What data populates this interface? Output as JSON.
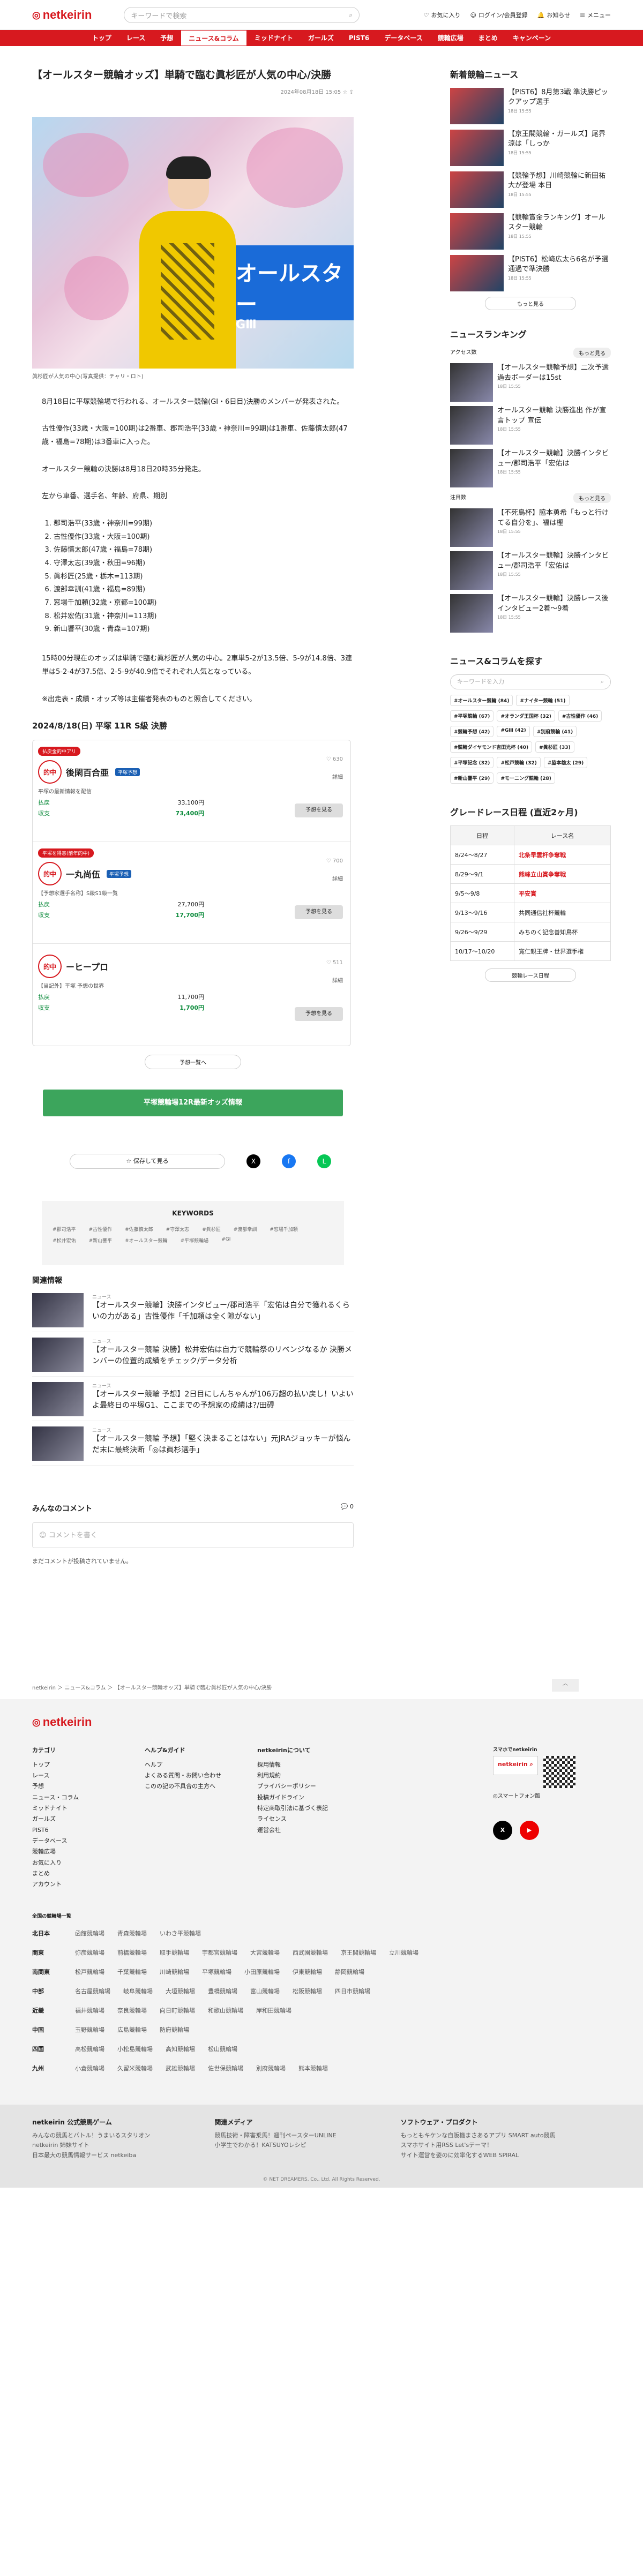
{
  "header": {
    "logo": "netkeirin",
    "search_placeholder": "キーワードで検索",
    "links": [
      "お気に入り",
      "ログイン/会員登録",
      "お知らせ",
      "メニュー"
    ]
  },
  "nav": [
    "トップ",
    "レース",
    "予想",
    "ニュース&コラム",
    "ミッドナイト",
    "ガールズ",
    "PIST6",
    "データベース",
    "競輪広場",
    "まとめ",
    "キャンペーン"
  ],
  "article": {
    "title": "【オールスター競輪オッズ】単騎で臨む眞杉匠が人気の中心/決勝",
    "meta": "2024年08月18日 15:05",
    "caption": "眞杉匠が人気の中心(写真提供：チャリ・ロト)",
    "p1": "8月18日に平塚競輪場で行われる、オールスター競輪(GⅠ・6日目)決勝のメンバーが発表された。",
    "p2": "古性優作(33歳・大阪=100期)は2番車、郡司浩平(33歳・神奈川=99期)は1番車、佐藤慎太郎(47歳・福島=78期)は3番車に入った。",
    "p3": "オールスター競輪の決勝は8月18日20時35分発走。",
    "lineup_intro": "左から車番、選手名、年齢、府県、期別",
    "lineup": [
      "郡司浩平(33歳・神奈川=99期)",
      "古性優作(33歳・大阪=100期)",
      "佐藤慎太郎(47歳・福島=78期)",
      "守澤太志(39歳・秋田=96期)",
      "眞杉匠(25歳・栃木=113期)",
      "渡部幸訓(41歳・福島=89期)",
      "窓場千加頼(32歳・京都=100期)",
      "松井宏佑(31歳・神奈川=113期)",
      "新山響平(30歳・青森=107期)"
    ],
    "p4": "15時00分現在のオッズは単騎で臨む眞杉匠が人気の中心。2車単5-2が13.5倍、5-9が14.8倍、3連単は5-2-4が37.5倍、2-5-9が40.9倍でそれぞれ人気となっている。",
    "note": "※出走表・成績・オッズ等は主催者発表のものと照合してください。"
  },
  "race_heading": "2024/8/18(日) 平塚 11R S級 決勝",
  "cards": [
    {
      "tag": "払戻金的中アリ",
      "name": "後閑百合亜",
      "badge": "平塚予想",
      "desc": "平塚の最新情報を配信",
      "likes": "630",
      "detail": "詳細",
      "rows": [
        [
          "払戻",
          "33,100円"
        ],
        [
          "収支",
          "73,400円"
        ]
      ],
      "bet": "予想を見る"
    },
    {
      "tag": "平塚を得意(前年的中)",
      "name": "一丸尚伍",
      "badge": "平塚予想",
      "desc": "【予想家選手名称】S級S1級一覧",
      "likes": "700",
      "detail": "詳細",
      "rows": [
        [
          "払戻",
          "27,700円"
        ],
        [
          "収支",
          "17,700円"
        ]
      ],
      "bet": "予想を見る"
    },
    {
      "tag": "",
      "name": "ーヒープロ",
      "badge": "",
      "desc": "【当記外】平塚 予想の世界",
      "likes": "511",
      "detail": "詳細",
      "rows": [
        [
          "払戻",
          "11,700円"
        ],
        [
          "収支",
          "1,700円"
        ]
      ],
      "bet": "予想を見る"
    }
  ],
  "more_predict": "予想一覧へ",
  "green_button": "平塚競輪場12R最新オッズ情報",
  "save_label": "保存して見る",
  "keywords_title": "KEYWORDS",
  "keywords": [
    "#郡司浩平",
    "#古性優作",
    "#佐藤慎太郎",
    "#守澤太志",
    "#眞杉匠",
    "#渡部幸訓",
    "#窓場千加頼",
    "#松井宏佑",
    "#新山響平",
    "#オールスター競輪",
    "#平塚競輪場",
    "#GI"
  ],
  "related": {
    "title": "関連情報",
    "items": [
      {
        "cat": "ニュース",
        "text": "【オールスター競輪】決勝インタビュー/郡司浩平「宏佑は自分で獲れるくらいの力がある」古性優作「千加頼は全く隙がない」"
      },
      {
        "cat": "ニュース",
        "text": "【オールスター競輪 決勝】松井宏佑は自力で競輪祭のリベンジなるか 決勝メンバーの位置的成績をチェック/データ分析"
      },
      {
        "cat": "ニュース",
        "text": "【オールスター競輪 予想】2日目にしんちゃんが106万超の払い戻し！いよいよ最終日の平塚G1、ここまでの予想家の成績は?/田碍"
      },
      {
        "cat": "ニュース",
        "text": "【オールスター競輪 予想】「堅く決まることはない」元JRAジョッキーが悩んだ末に最終決断「◎は眞杉選手」"
      }
    ]
  },
  "comments": {
    "title": "みんなのコメント",
    "count": "0",
    "placeholder": "コメントを書く",
    "none": "まだコメントが投稿されていません。"
  },
  "sidebar": {
    "news_title": "新着競輪ニュース",
    "news": [
      {
        "text": "【PIST6】8月第3戦 準決勝ピックアップ選手",
        "date": "18日 15:55"
      },
      {
        "text": "【京王閣競輪・ガールズ】尾界涼は「しっか",
        "date": "18日 15:55"
      },
      {
        "text": "【競輪予想】川崎競輪に新田祐大が登場 本日",
        "date": "18日 15:55"
      },
      {
        "text": "【競輪賞金ランキング】オールスター競輪",
        "date": "18日 15:55"
      },
      {
        "text": "【PIST6】松﨑広太ら6名が予選通過で準決勝",
        "date": "18日 15:55"
      }
    ],
    "more": "もっと見る",
    "ranking_title": "ニュースランキング",
    "ranking_tab1": "アクセス数",
    "ranking_tab2": "注目数",
    "ranking_more": "もっと見る",
    "ranking": [
      {
        "text": "【オールスター競輪予想】二次予選過去ボーダーは15st",
        "date": "18日 15:55"
      },
      {
        "text": "オールスター競輪 決勝進出 作が宣言トップ 宣伝",
        "date": "18日 15:55"
      },
      {
        "text": "【オールスター競輪】決勝インタビュー/郡司浩平「宏佑は",
        "date": "18日 15:55"
      },
      {
        "text": "【不死鳥杯】脇本勇希「もっと行けてる自分を」、福は樫",
        "date": "18日 15:55"
      },
      {
        "text": "【オールスター競輪】決勝インタビュー/郡司浩平「宏佑は",
        "date": "18日 15:55"
      },
      {
        "text": "【オールスター競輪】決勝レース後インタビュー2着～9着",
        "date": "18日 15:55"
      }
    ],
    "search_title": "ニュース&コラムを探す",
    "search_placeholder": "キーワードを入力",
    "chips": [
      "#オールスター競輪 (84)",
      "#ナイター競輪 (51)",
      "#平塚競輪 (67)",
      "#オランダ王国杯 (32)",
      "#古性優作 (46)",
      "#競輪予想 (42)",
      "#GⅢ (42)",
      "#別府競輪 (41)",
      "#競輪ダイヤモンド吉田光杯 (40)",
      "#眞杉匠 (33)",
      "#平塚記念 (32)",
      "#松戸競輪 (32)",
      "#脇本雄太 (29)",
      "#新山響平 (29)",
      "#モーニング競輪 (28)"
    ],
    "schedule_title": "グレードレース日程 (直近2ヶ月)",
    "schedule_head": [
      "日程",
      "レース名"
    ],
    "schedule": [
      [
        "8/24〜8/27",
        "北条早雲杆争奪戦"
      ],
      [
        "8/29〜9/1",
        "熊峰立山賞争奪戦"
      ],
      [
        "9/5〜9/8",
        "平安賞"
      ],
      [
        "9/13〜9/16",
        "共同通信社杯競輪"
      ],
      [
        "9/26〜9/29",
        "みちのく記念善知鳥杯"
      ],
      [
        "10/17〜10/20",
        "寛仁親王牌・世界選手権"
      ]
    ],
    "schedule_more": "競輪レース日程"
  },
  "breadcrumb": "netkeirin ＞ ニュース&コラム ＞ 【オールスター競輪オッズ】単騎で臨む眞杉匠が人気の中心/決勝",
  "footer": {
    "categories_title": "カテゴリ",
    "categories": [
      "トップ",
      "レース",
      "予想",
      "ニュース・コラム",
      "ミッドナイト",
      "ガールズ",
      "PIST6",
      "データベース",
      "競輪広場",
      "お気に入り",
      "まとめ",
      "アカウント"
    ],
    "help_title": "ヘルプ&ガイド",
    "help": [
      "ヘルプ",
      "よくある質問・お問い合わせ",
      "このの記の不具合の主方へ"
    ],
    "about_title": "netkeirinについて",
    "about": [
      "採用情報",
      "利用規約",
      "プライバシーポリシー",
      "投稿ガイドライン",
      "特定商取引法に基づく表記",
      "ライセンス",
      "運営会社"
    ],
    "app_title": "スマホでnetkeirin",
    "app_label": "netkeirin",
    "app_note": "◎スマートフォン版",
    "tracks_title": "全国の競輪場一覧",
    "tracks": [
      {
        "reg": "北日本",
        "list": [
          "函館競輪場",
          "青森競輪場",
          "いわき平競輪場"
        ]
      },
      {
        "reg": "関東",
        "list": [
          "弥彦競輪場",
          "前橋競輪場",
          "取手競輪場",
          "宇都宮競輪場",
          "大宮競輪場",
          "西武園競輪場",
          "京王閣競輪場",
          "立川競輪場"
        ]
      },
      {
        "reg": "南関東",
        "list": [
          "松戸競輪場",
          "千葉競輪場",
          "川崎競輪場",
          "平塚競輪場",
          "小田原競輪場",
          "伊東競輪場",
          "静岡競輪場"
        ]
      },
      {
        "reg": "中部",
        "list": [
          "名古屋競輪場",
          "岐阜競輪場",
          "大垣競輪場",
          "豊橋競輪場",
          "富山競輪場",
          "松阪競輪場",
          "四日市競輪場"
        ]
      },
      {
        "reg": "近畿",
        "list": [
          "福井競輪場",
          "奈良競輪場",
          "向日町競輪場",
          "和歌山競輪場",
          "岸和田競輪場"
        ]
      },
      {
        "reg": "中国",
        "list": [
          "玉野競輪場",
          "広島競輪場",
          "防府競輪場"
        ]
      },
      {
        "reg": "四国",
        "list": [
          "高松競輪場",
          "小松島競輪場",
          "高知競輪場",
          "松山競輪場"
        ]
      },
      {
        "reg": "九州",
        "list": [
          "小倉競輪場",
          "久留米競輪場",
          "武雄競輪場",
          "佐世保競輪場",
          "別府競輪場",
          "熊本競輪場"
        ]
      }
    ],
    "groups": [
      {
        "title": "netkeirin 公式競馬ゲーム",
        "items": [
          "みんなの競馬とバトル！うまいるスタリオン",
          "netkeirin 姉妹サイト",
          "日本最大の競馬情報サービス netkeiba"
        ]
      },
      {
        "title": "関連メディア",
        "items": [
          "競馬技術・障害乗馬！週刊ペースターUNLINE",
          "小学生でわかる！KATSUYOレシピ"
        ]
      },
      {
        "title": "ソフトウェア・プロダクト",
        "items": [
          "もっともキケンな自販機まさあるアプリ SMART auto競馬",
          "スマホサイト用RSS Let'sテーマ！",
          "サイト運営を姿のに効率化するWEB SPIRAL"
        ]
      }
    ],
    "copyright": "© NET DREAMERS, Co., Ltd. All Rights Reserved."
  }
}
